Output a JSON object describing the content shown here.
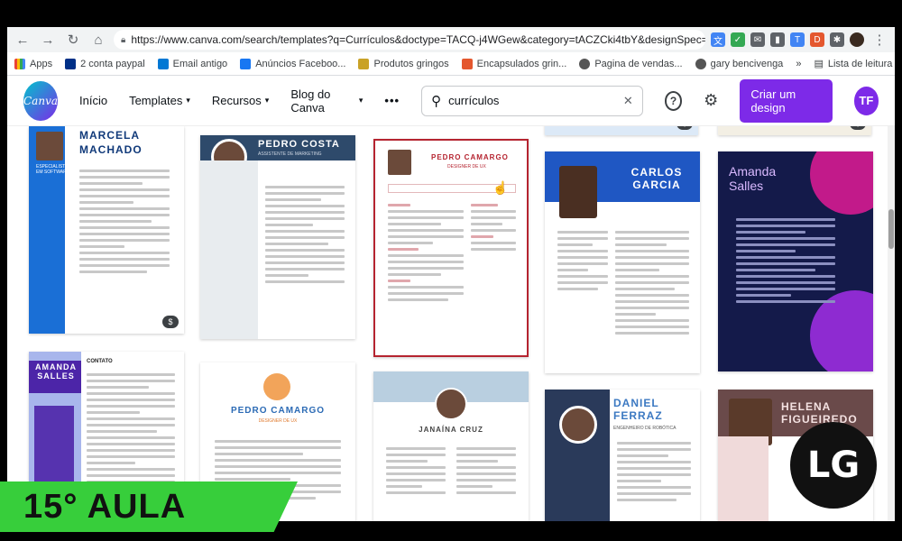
{
  "browser": {
    "url": "https://www.canva.com/search/templates?q=Currículos&doctype=TACQ-j4WGew&category=tACZCki4tbY&designSpec=...",
    "bookmarks": [
      {
        "label": "Apps",
        "color": "#ea4335"
      },
      {
        "label": "2 conta paypal",
        "color": "#003087"
      },
      {
        "label": "Email antigo",
        "color": "#0078d4"
      },
      {
        "label": "Anúncios Faceboo...",
        "color": "#1877f2"
      },
      {
        "label": "Produtos gringos",
        "color": "#c9a227"
      },
      {
        "label": "Encapsulados grin...",
        "color": "#e4572e"
      },
      {
        "label": "Pagina de vendas...",
        "color": "#555555"
      },
      {
        "label": "gary bencivenga",
        "color": "#555555"
      }
    ],
    "reading_list": "Lista de leitura"
  },
  "canva": {
    "logo_text": "Canva",
    "nav": [
      "Início",
      "Templates",
      "Recursos",
      "Blog do Canva"
    ],
    "search_value": "currículos",
    "create_button": "Criar um design",
    "avatar": "TF"
  },
  "templates": [
    {
      "name": "MARCELA MACHADO",
      "subtitle": "ESPECIALISTA EM SOFTWARE"
    },
    {
      "name": "PEDRO COSTA",
      "subtitle": "ASSISTENTE DE MARKETING"
    },
    {
      "name": "PEDRO CAMARGO",
      "subtitle": "DESIGNER DE UX"
    },
    {
      "name": "CARLOS GARCIA",
      "subtitle": ""
    },
    {
      "name": "Amanda Salles",
      "subtitle": ""
    },
    {
      "name": "AMANDA SALLES",
      "subtitle": "CONTATO"
    },
    {
      "name": "PEDRO CAMARGO",
      "subtitle": "DESIGNER DE UX"
    },
    {
      "name": "JANAÍNA CRUZ",
      "subtitle": ""
    },
    {
      "name": "DANIEL FERRAZ",
      "subtitle": "ENGENHEIRO DE ROBÓTICA"
    },
    {
      "name": "HELENA FIGUEIREDO",
      "subtitle": ""
    }
  ],
  "overlay": {
    "lesson": "15° AULA",
    "logo": "LG"
  },
  "colors": {
    "accent": "#7d2ae8",
    "lesson_bg": "#37ce3b"
  }
}
